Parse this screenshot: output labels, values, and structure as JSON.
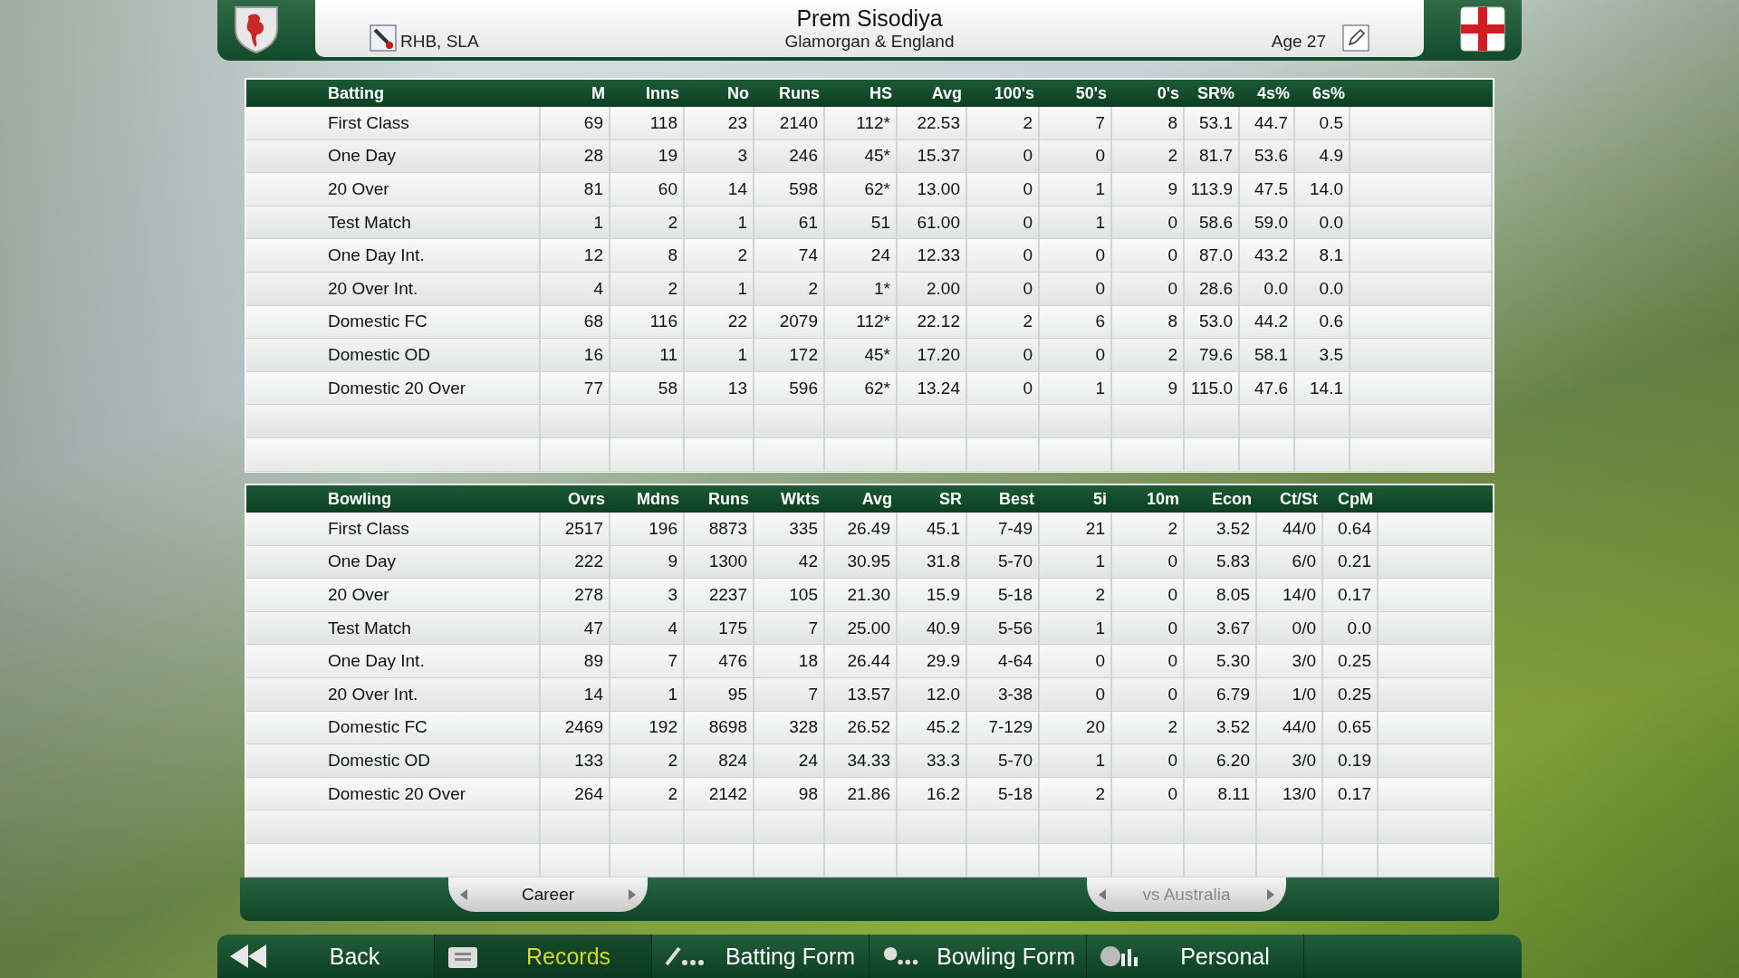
{
  "player": {
    "name": "Prem Sisodiya",
    "role": "RHB, SLA",
    "team": "Glamorgan & England",
    "age": "Age 27"
  },
  "batting": {
    "columns": [
      "Batting",
      "M",
      "Inns",
      "No",
      "Runs",
      "HS",
      "Avg",
      "100's",
      "50's",
      "0's",
      "SR%",
      "4s%",
      "6s%"
    ],
    "rows": [
      {
        "label": "First Class",
        "values": [
          "69",
          "118",
          "23",
          "2140",
          "112*",
          "22.53",
          "2",
          "7",
          "8",
          "53.1",
          "44.7",
          "0.5"
        ]
      },
      {
        "label": "One Day",
        "values": [
          "28",
          "19",
          "3",
          "246",
          "45*",
          "15.37",
          "0",
          "0",
          "2",
          "81.7",
          "53.6",
          "4.9"
        ]
      },
      {
        "label": "20 Over",
        "values": [
          "81",
          "60",
          "14",
          "598",
          "62*",
          "13.00",
          "0",
          "1",
          "9",
          "113.9",
          "47.5",
          "14.0"
        ]
      },
      {
        "label": "Test Match",
        "values": [
          "1",
          "2",
          "1",
          "61",
          "51",
          "61.00",
          "0",
          "1",
          "0",
          "58.6",
          "59.0",
          "0.0"
        ]
      },
      {
        "label": "One Day Int.",
        "values": [
          "12",
          "8",
          "2",
          "74",
          "24",
          "12.33",
          "0",
          "0",
          "0",
          "87.0",
          "43.2",
          "8.1"
        ]
      },
      {
        "label": "20 Over Int.",
        "values": [
          "4",
          "2",
          "1",
          "2",
          "1*",
          "2.00",
          "0",
          "0",
          "0",
          "28.6",
          "0.0",
          "0.0"
        ]
      },
      {
        "label": "Domestic FC",
        "values": [
          "68",
          "116",
          "22",
          "2079",
          "112*",
          "22.12",
          "2",
          "6",
          "8",
          "53.0",
          "44.2",
          "0.6"
        ]
      },
      {
        "label": "Domestic OD",
        "values": [
          "16",
          "11",
          "1",
          "172",
          "45*",
          "17.20",
          "0",
          "0",
          "2",
          "79.6",
          "58.1",
          "3.5"
        ]
      },
      {
        "label": "Domestic 20 Over",
        "values": [
          "77",
          "58",
          "13",
          "596",
          "62*",
          "13.24",
          "0",
          "1",
          "9",
          "115.0",
          "47.6",
          "14.1"
        ]
      }
    ]
  },
  "bowling": {
    "columns": [
      "Bowling",
      "Ovrs",
      "Mdns",
      "Runs",
      "Wkts",
      "Avg",
      "SR",
      "Best",
      "5i",
      "10m",
      "Econ",
      "Ct/St",
      "CpM"
    ],
    "rows": [
      {
        "label": "First Class",
        "values": [
          "2517",
          "196",
          "8873",
          "335",
          "26.49",
          "45.1",
          "7-49",
          "21",
          "2",
          "3.52",
          "44/0",
          "0.64"
        ]
      },
      {
        "label": "One Day",
        "values": [
          "222",
          "9",
          "1300",
          "42",
          "30.95",
          "31.8",
          "5-70",
          "1",
          "0",
          "5.83",
          "6/0",
          "0.21"
        ]
      },
      {
        "label": "20 Over",
        "values": [
          "278",
          "3",
          "2237",
          "105",
          "21.30",
          "15.9",
          "5-18",
          "2",
          "0",
          "8.05",
          "14/0",
          "0.17"
        ]
      },
      {
        "label": "Test Match",
        "values": [
          "47",
          "4",
          "175",
          "7",
          "25.00",
          "40.9",
          "5-56",
          "1",
          "0",
          "3.67",
          "0/0",
          "0.0"
        ]
      },
      {
        "label": "One Day Int.",
        "values": [
          "89",
          "7",
          "476",
          "18",
          "26.44",
          "29.9",
          "4-64",
          "0",
          "0",
          "5.30",
          "3/0",
          "0.25"
        ]
      },
      {
        "label": "20 Over Int.",
        "values": [
          "14",
          "1",
          "95",
          "7",
          "13.57",
          "12.0",
          "3-38",
          "0",
          "0",
          "6.79",
          "1/0",
          "0.25"
        ]
      },
      {
        "label": "Domestic FC",
        "values": [
          "2469",
          "192",
          "8698",
          "328",
          "26.52",
          "45.2",
          "7-129",
          "20",
          "2",
          "3.52",
          "44/0",
          "0.65"
        ]
      },
      {
        "label": "Domestic OD",
        "values": [
          "133",
          "2",
          "824",
          "24",
          "34.33",
          "33.3",
          "5-70",
          "1",
          "0",
          "6.20",
          "3/0",
          "0.19"
        ]
      },
      {
        "label": "Domestic 20 Over",
        "values": [
          "264",
          "2",
          "2142",
          "98",
          "21.86",
          "16.2",
          "5-18",
          "2",
          "0",
          "8.11",
          "13/0",
          "0.17"
        ]
      }
    ]
  },
  "selectors": [
    {
      "label": "Career",
      "disabled": false
    },
    {
      "label": "vs Australia",
      "disabled": true
    }
  ],
  "nav": [
    {
      "kind": "back",
      "label": "Back",
      "selected": false
    },
    {
      "kind": "records",
      "label": "Records",
      "selected": true
    },
    {
      "kind": "batting",
      "label": "Batting Form",
      "selected": false
    },
    {
      "kind": "bowling",
      "label": "Bowling Form",
      "selected": false
    },
    {
      "kind": "personal",
      "label": "Personal",
      "selected": false
    }
  ]
}
